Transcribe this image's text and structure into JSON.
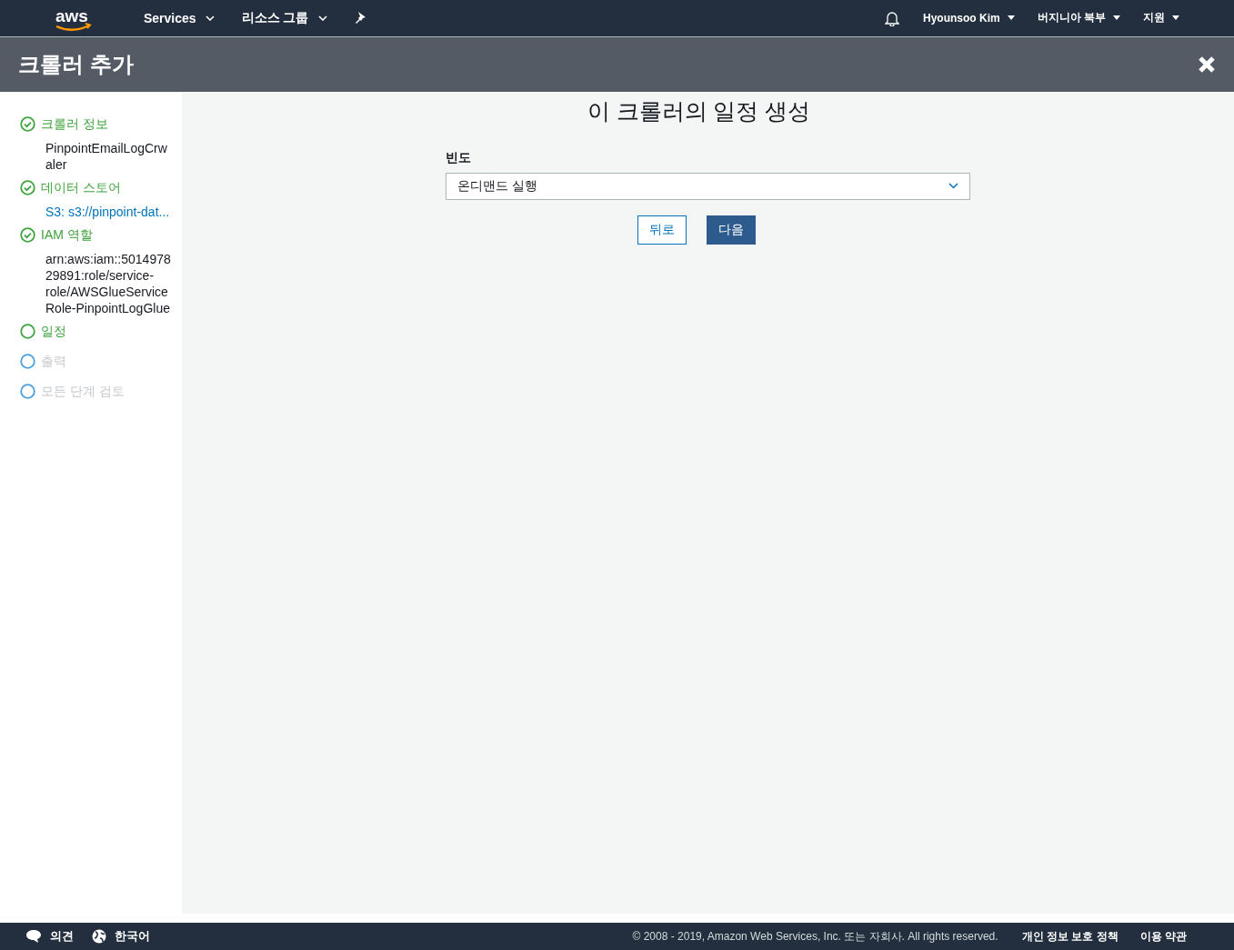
{
  "top_nav": {
    "logo": "aws",
    "menus": [
      {
        "label": "Services"
      },
      {
        "label": "리소스 그룹"
      }
    ],
    "right_menus": [
      {
        "label": "Hyounsoo Kim"
      },
      {
        "label": "버지니아 북부"
      },
      {
        "label": "지원"
      }
    ]
  },
  "header": {
    "title": "크롤러 추가"
  },
  "steps": [
    {
      "label": "크롤러 정보",
      "completed": true,
      "enabled": true,
      "detail": {
        "kind": "text",
        "text": "PinpointEmailLogCrwaler"
      }
    },
    {
      "label": "데이터 스토어",
      "completed": true,
      "enabled": true,
      "detail": {
        "kind": "link",
        "text": "S3: s3://pinpoint-dat..."
      }
    },
    {
      "label": "IAM 역할",
      "completed": true,
      "enabled": true,
      "detail": {
        "kind": "text",
        "text": "arn:aws:iam::501497829891:role/service-role/AWSGlueServiceRole-PinpointLogGlue"
      }
    },
    {
      "label": "일정",
      "completed": false,
      "enabled": true
    },
    {
      "label": "출력",
      "completed": false,
      "enabled": false
    },
    {
      "label": "모든 단계 검토",
      "completed": false,
      "enabled": false
    }
  ],
  "form": {
    "title": "이 크롤러의 일정 생성",
    "field_label": "빈도",
    "frequency": "온디맨드 실행",
    "buttons": [
      {
        "label": "뒤로",
        "kind": "secondary"
      },
      {
        "label": "다음",
        "kind": "primary"
      }
    ]
  },
  "footer": {
    "feedback": "의견",
    "language": "한국어",
    "copyright": "© 2008 - 2019, Amazon Web Services, Inc. 또는 자회사. All rights reserved.",
    "links": [
      "개인 정보 보호 정책",
      "이용 약관"
    ]
  }
}
